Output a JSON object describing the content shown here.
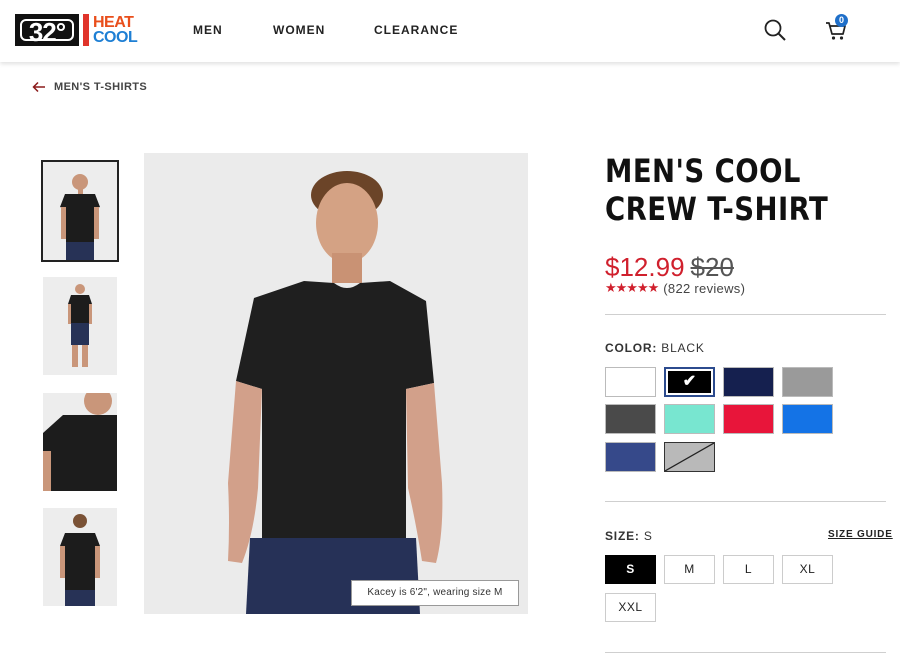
{
  "brand": {
    "logo_number": "32°",
    "logo_word_1": "HEAT",
    "logo_word_2": "COOL",
    "colors": {
      "heat": "#e94e1b",
      "cool": "#1e7fd4",
      "accent": "#d0202d"
    }
  },
  "header": {
    "nav": [
      "MEN",
      "WOMEN",
      "CLEARANCE"
    ],
    "search_icon": "search-icon",
    "cart_icon": "cart-icon",
    "cart_count": "0"
  },
  "breadcrumb": {
    "back_icon": "arrow-left-icon",
    "label": "MEN'S T-SHIRTS"
  },
  "gallery": {
    "thumbnails": [
      "front view",
      "full body view",
      "shoulder close-up",
      "back view"
    ],
    "selected_thumbnail": 0,
    "caption": "Kacey is 6'2\", wearing size M"
  },
  "product": {
    "title": "MEN'S COOL CREW T-SHIRT",
    "sale_price": "$12.99",
    "original_price": "$20",
    "rating_stars": "★★★★★",
    "reviews": "(822 reviews)",
    "color_label": "COLOR:",
    "color_value": "BLACK",
    "swatches": [
      {
        "color": "#ffffff",
        "selected": false,
        "available": true
      },
      {
        "color": "#000000",
        "selected": true,
        "available": true
      },
      {
        "color": "#15204f",
        "selected": false,
        "available": true
      },
      {
        "color": "#9a9a9a",
        "selected": false,
        "available": true
      },
      {
        "color": "#4a4a4a",
        "selected": false,
        "available": true
      },
      {
        "color": "#78e6d0",
        "selected": false,
        "available": true
      },
      {
        "color": "#e8153a",
        "selected": false,
        "available": true
      },
      {
        "color": "#1473e6",
        "selected": false,
        "available": true
      },
      {
        "color": "#36498a",
        "selected": false,
        "available": true
      },
      {
        "color": "#b9b9b9",
        "selected": false,
        "available": false
      }
    ],
    "check_glyph": "✔",
    "size_label": "SIZE:",
    "size_value": "S",
    "size_guide": "SIZE GUIDE",
    "sizes": [
      "S",
      "M",
      "L",
      "XL",
      "XXL"
    ],
    "selected_size": "S"
  }
}
